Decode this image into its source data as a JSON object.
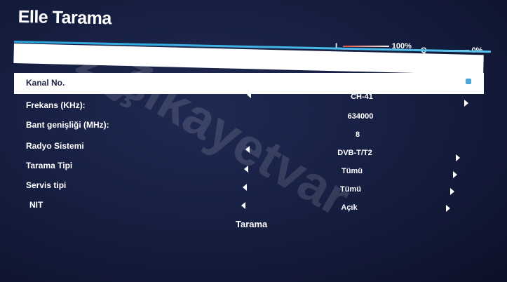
{
  "window": {
    "title": "Elle Tarama"
  },
  "meters": {
    "l_label": "L",
    "l_value": "100%",
    "l_level": 1.0,
    "q_label": "Q",
    "q_value": "0%",
    "q_level": 0.0
  },
  "rows": [
    {
      "label": "Kanal No.",
      "value": "CH-41"
    },
    {
      "label": "Frekans (KHz):",
      "value": "634000"
    },
    {
      "label": "Bant genişliği (MHz):",
      "value": "8"
    },
    {
      "label": "Radyo Sistemi",
      "value": "DVB-T/T2"
    },
    {
      "label": "Tarama Tipi",
      "value": "Tümü"
    },
    {
      "label": "Servis tipi",
      "value": "Tümü"
    },
    {
      "label": "NIT",
      "value": "Açık"
    }
  ],
  "scan_button": "Tarama",
  "watermark": "şikayetvar",
  "colors": {
    "accent": "#2aa3d8",
    "background": "#1a2347",
    "highlight": "#ffffff"
  }
}
